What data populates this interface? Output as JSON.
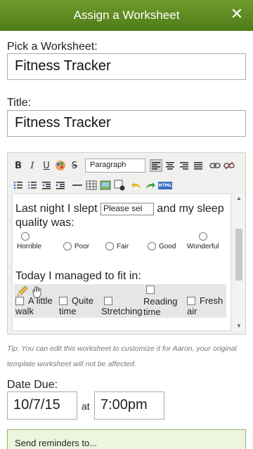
{
  "header": {
    "title": "Assign a Worksheet",
    "close_icon": "close-icon"
  },
  "worksheet": {
    "label": "Pick a Worksheet:",
    "value": "Fitness Tracker"
  },
  "title_field": {
    "label": "Title:",
    "value": "Fitness Tracker"
  },
  "toolbar": {
    "format_value": "Paragraph",
    "icons_row1": [
      "bold-icon",
      "italic-icon",
      "underline-icon",
      "color-icon",
      "strikethrough-icon",
      "format-select",
      "align-left-icon",
      "align-center-icon",
      "align-right-icon",
      "justify-icon",
      "link-icon",
      "unlink-icon"
    ],
    "icons_row2": [
      "bullet-list-icon",
      "numbered-list-icon",
      "outdent-icon",
      "indent-icon",
      "horizontal-rule-icon",
      "table-icon",
      "image-icon",
      "form-field-icon",
      "undo-icon",
      "redo-icon",
      "html-icon"
    ],
    "glyphs": {
      "bold": "B",
      "italic": "I",
      "underline": "U",
      "strike": "S",
      "html": "HTML"
    }
  },
  "editor": {
    "sleep_line_prefix": "Last night I slept",
    "sleep_select": "Please sel",
    "sleep_line_suffix": "and my sleep",
    "quality_line": "quality was:",
    "quality_options": [
      "Horrible",
      "Poor",
      "Fair",
      "Good",
      "Wonderful"
    ],
    "fit_line": "Today I managed to fit in:",
    "fit_options": [
      {
        "line1": "A little",
        "line2": "walk"
      },
      {
        "line1": "Quite",
        "line2": "time"
      },
      {
        "line1": "",
        "line2": "Stretching"
      },
      {
        "line1": "Reading",
        "line2": "time"
      },
      {
        "line1": "Fresh",
        "line2": "air"
      }
    ]
  },
  "tip": "Tip: You can edit this worksheet to customize it for Aaron, your original template worksheet will not be affected.",
  "date_due": {
    "label": "Date Due:",
    "date": "10/7/15",
    "at": "at",
    "time": "7:00pm"
  },
  "reminders": {
    "label": "Send reminders to..."
  }
}
